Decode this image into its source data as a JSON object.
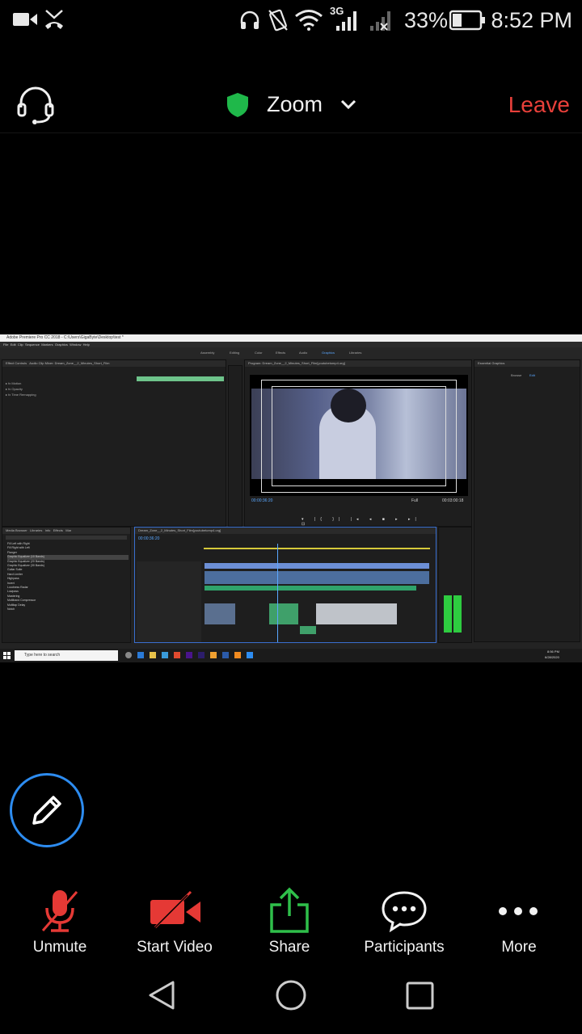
{
  "status_bar": {
    "network": "3G",
    "battery_percent": "33%",
    "time": "8:52 PM",
    "icons": [
      "video-recorder-icon",
      "missed-call-icon",
      "headphones-icon",
      "vibrate-icon",
      "wifi-icon",
      "signal-icon",
      "signal-no-sim-icon",
      "battery-icon"
    ]
  },
  "top_bar": {
    "title": "Zoom",
    "leave_label": "Leave",
    "shield_color": "#1fb84a",
    "leave_color": "#e8403a"
  },
  "shared_screen": {
    "window_title": "Adobe Premiere Pro CC 2018 - C:\\Users\\GigaByte\\Desktop\\test *",
    "menu_items": [
      "File",
      "Edit",
      "Clip",
      "Sequence",
      "Markers",
      "Graphics",
      "Window",
      "Help"
    ],
    "workspaces": [
      "Assembly",
      "Editing",
      "Color",
      "Effects",
      "Audio",
      "Graphics",
      "Libraries"
    ],
    "effect_controls_tab": "Effect Controls",
    "source_tab": "Audio Clip Mixer: Dream_Zone__2_Minutes_Short_Film",
    "program_title": "Program: Dream_Zone__2_Minutes_Short_Film[youtubetomp4.org]",
    "program_timecode": "00:00:36:20",
    "program_fit": "Full",
    "program_duration": "00:03:00:18",
    "essential_graphics": "Essential Graphics",
    "eg_tabs": [
      "Browse",
      "Edit"
    ],
    "timeline_title": "Dream_Zone__2_Minutes_Short_Film[youtubetomp4.org]",
    "timeline_timecode": "00:00:36:20",
    "effects_tabs": [
      "Media Browser",
      "Libraries",
      "Info",
      "Effects",
      "Mar"
    ],
    "effects_list": [
      "Fill Left with Right",
      "Fill Right with Left",
      "Flanger",
      "Graphic Equalizer (10 Bands)",
      "Graphic Equalizer (20 Bands)",
      "Graphic Equalizer (30 Bands)",
      "Guitar Suite",
      "Hard Limiter",
      "Highpass",
      "Invert",
      "Loudness Radar",
      "Lowpass",
      "Mastering",
      "Multiband Compressor",
      "Multitap Delay",
      "Notch"
    ],
    "taskbar_search": "Type here to search",
    "taskbar_time": "8:56 PM",
    "taskbar_date": "6/28/2020"
  },
  "toolbar": {
    "items": [
      {
        "label": "Unmute",
        "icon": "mic-muted-icon"
      },
      {
        "label": "Start Video",
        "icon": "video-off-icon"
      },
      {
        "label": "Share",
        "icon": "share-icon"
      },
      {
        "label": "Participants",
        "icon": "participants-icon"
      },
      {
        "label": "More",
        "icon": "more-icon"
      }
    ],
    "muted_color": "#e53935",
    "share_color": "#2fbf4a"
  },
  "nav_bar": {
    "icons": [
      "back-icon",
      "home-icon",
      "recents-icon"
    ]
  }
}
